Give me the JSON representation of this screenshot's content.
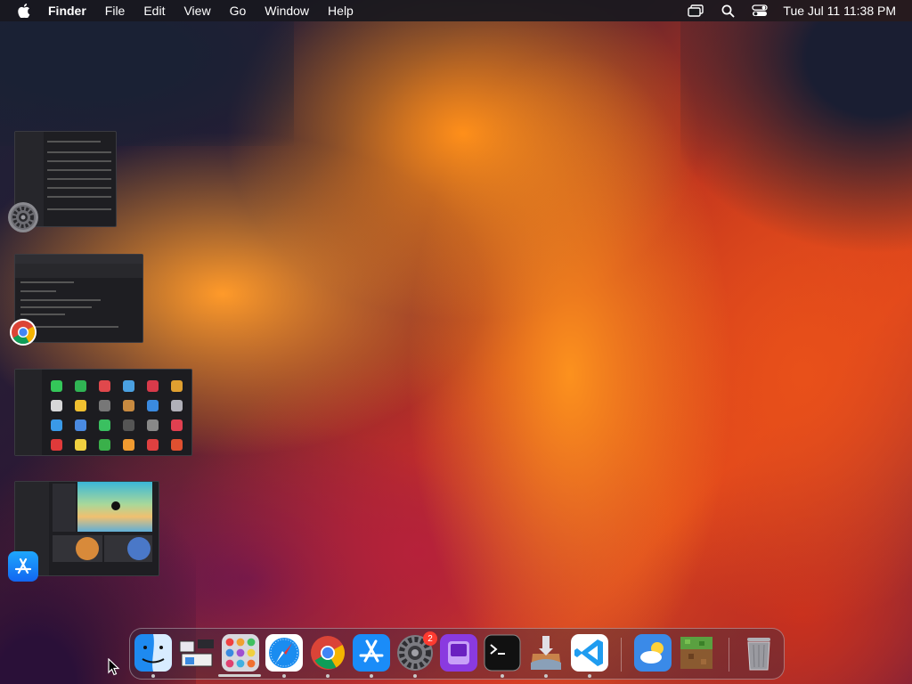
{
  "menubar": {
    "apple_icon": "apple-logo-icon",
    "app_name": "Finder",
    "items": [
      "File",
      "Edit",
      "View",
      "Go",
      "Window",
      "Help"
    ],
    "status_icons": [
      "display-mirroring-icon",
      "spotlight-search-icon",
      "control-center-icon"
    ],
    "clock": "Tue Jul 11  11:38 PM"
  },
  "windows": [
    {
      "app": "System Settings",
      "icon": "system-settings-icon"
    },
    {
      "app": "Google Chrome",
      "icon": "chrome-icon"
    },
    {
      "app": "Launchpad",
      "icon": "launchpad-icon"
    },
    {
      "app": "App Store",
      "icon": "app-store-icon"
    }
  ],
  "dock": {
    "apps": [
      {
        "name": "Finder",
        "icon": "finder-icon",
        "running": true
      },
      {
        "name": "Mission Control",
        "icon": "mission-control-icon",
        "running": false
      },
      {
        "name": "Launchpad",
        "icon": "launchpad-icon",
        "running": false
      },
      {
        "name": "Safari",
        "icon": "safari-icon",
        "running": true
      },
      {
        "name": "Google Chrome",
        "icon": "chrome-icon",
        "running": true
      },
      {
        "name": "App Store",
        "icon": "app-store-icon",
        "running": true
      },
      {
        "name": "System Settings",
        "icon": "system-settings-icon",
        "running": true,
        "badge": "2"
      },
      {
        "name": "Apple Configurator",
        "icon": "configurator-icon",
        "running": false
      },
      {
        "name": "Terminal",
        "icon": "terminal-icon",
        "running": true
      },
      {
        "name": "macOS Installer",
        "icon": "installer-icon",
        "running": true
      },
      {
        "name": "Visual Studio Code",
        "icon": "vscode-icon",
        "running": true
      },
      {
        "name": "Weather",
        "icon": "weather-icon",
        "running": false
      },
      {
        "name": "Minecraft",
        "icon": "minecraft-icon",
        "running": false
      },
      {
        "name": "Trash",
        "icon": "trash-icon",
        "running": false
      }
    ]
  }
}
